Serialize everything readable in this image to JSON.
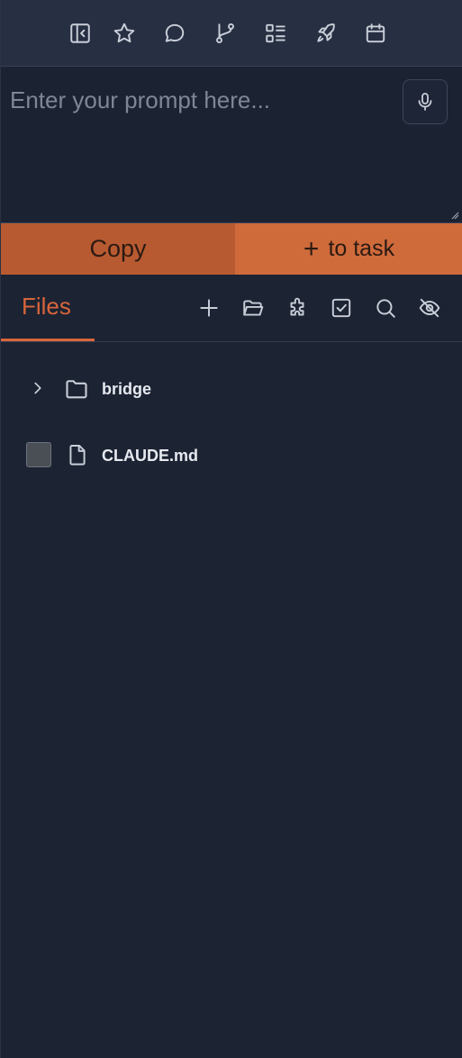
{
  "toolbar": {
    "icons": [
      "sidebar-collapse-icon",
      "star-icon",
      "chat-icon",
      "git-branch-icon",
      "list-icon",
      "rocket-icon",
      "calendar-icon"
    ]
  },
  "prompt": {
    "placeholder": "Enter your prompt here...",
    "value": ""
  },
  "actions": {
    "copy_label": "Copy",
    "to_task_label": "to task"
  },
  "files": {
    "tab_label": "Files",
    "header_icons": [
      "plus-icon",
      "folder-open-icon",
      "puzzle-icon",
      "checkbox-icon",
      "search-icon",
      "eye-off-icon"
    ],
    "items": [
      {
        "type": "folder",
        "label": "bridge"
      },
      {
        "type": "file",
        "label": "CLAUDE.md"
      }
    ]
  },
  "colors": {
    "accent": "#d8653a",
    "copy_bg": "#b85a31",
    "task_bg": "#cf6a3b",
    "panel_bg": "#1c2333",
    "toolbar_bg": "#273042"
  }
}
